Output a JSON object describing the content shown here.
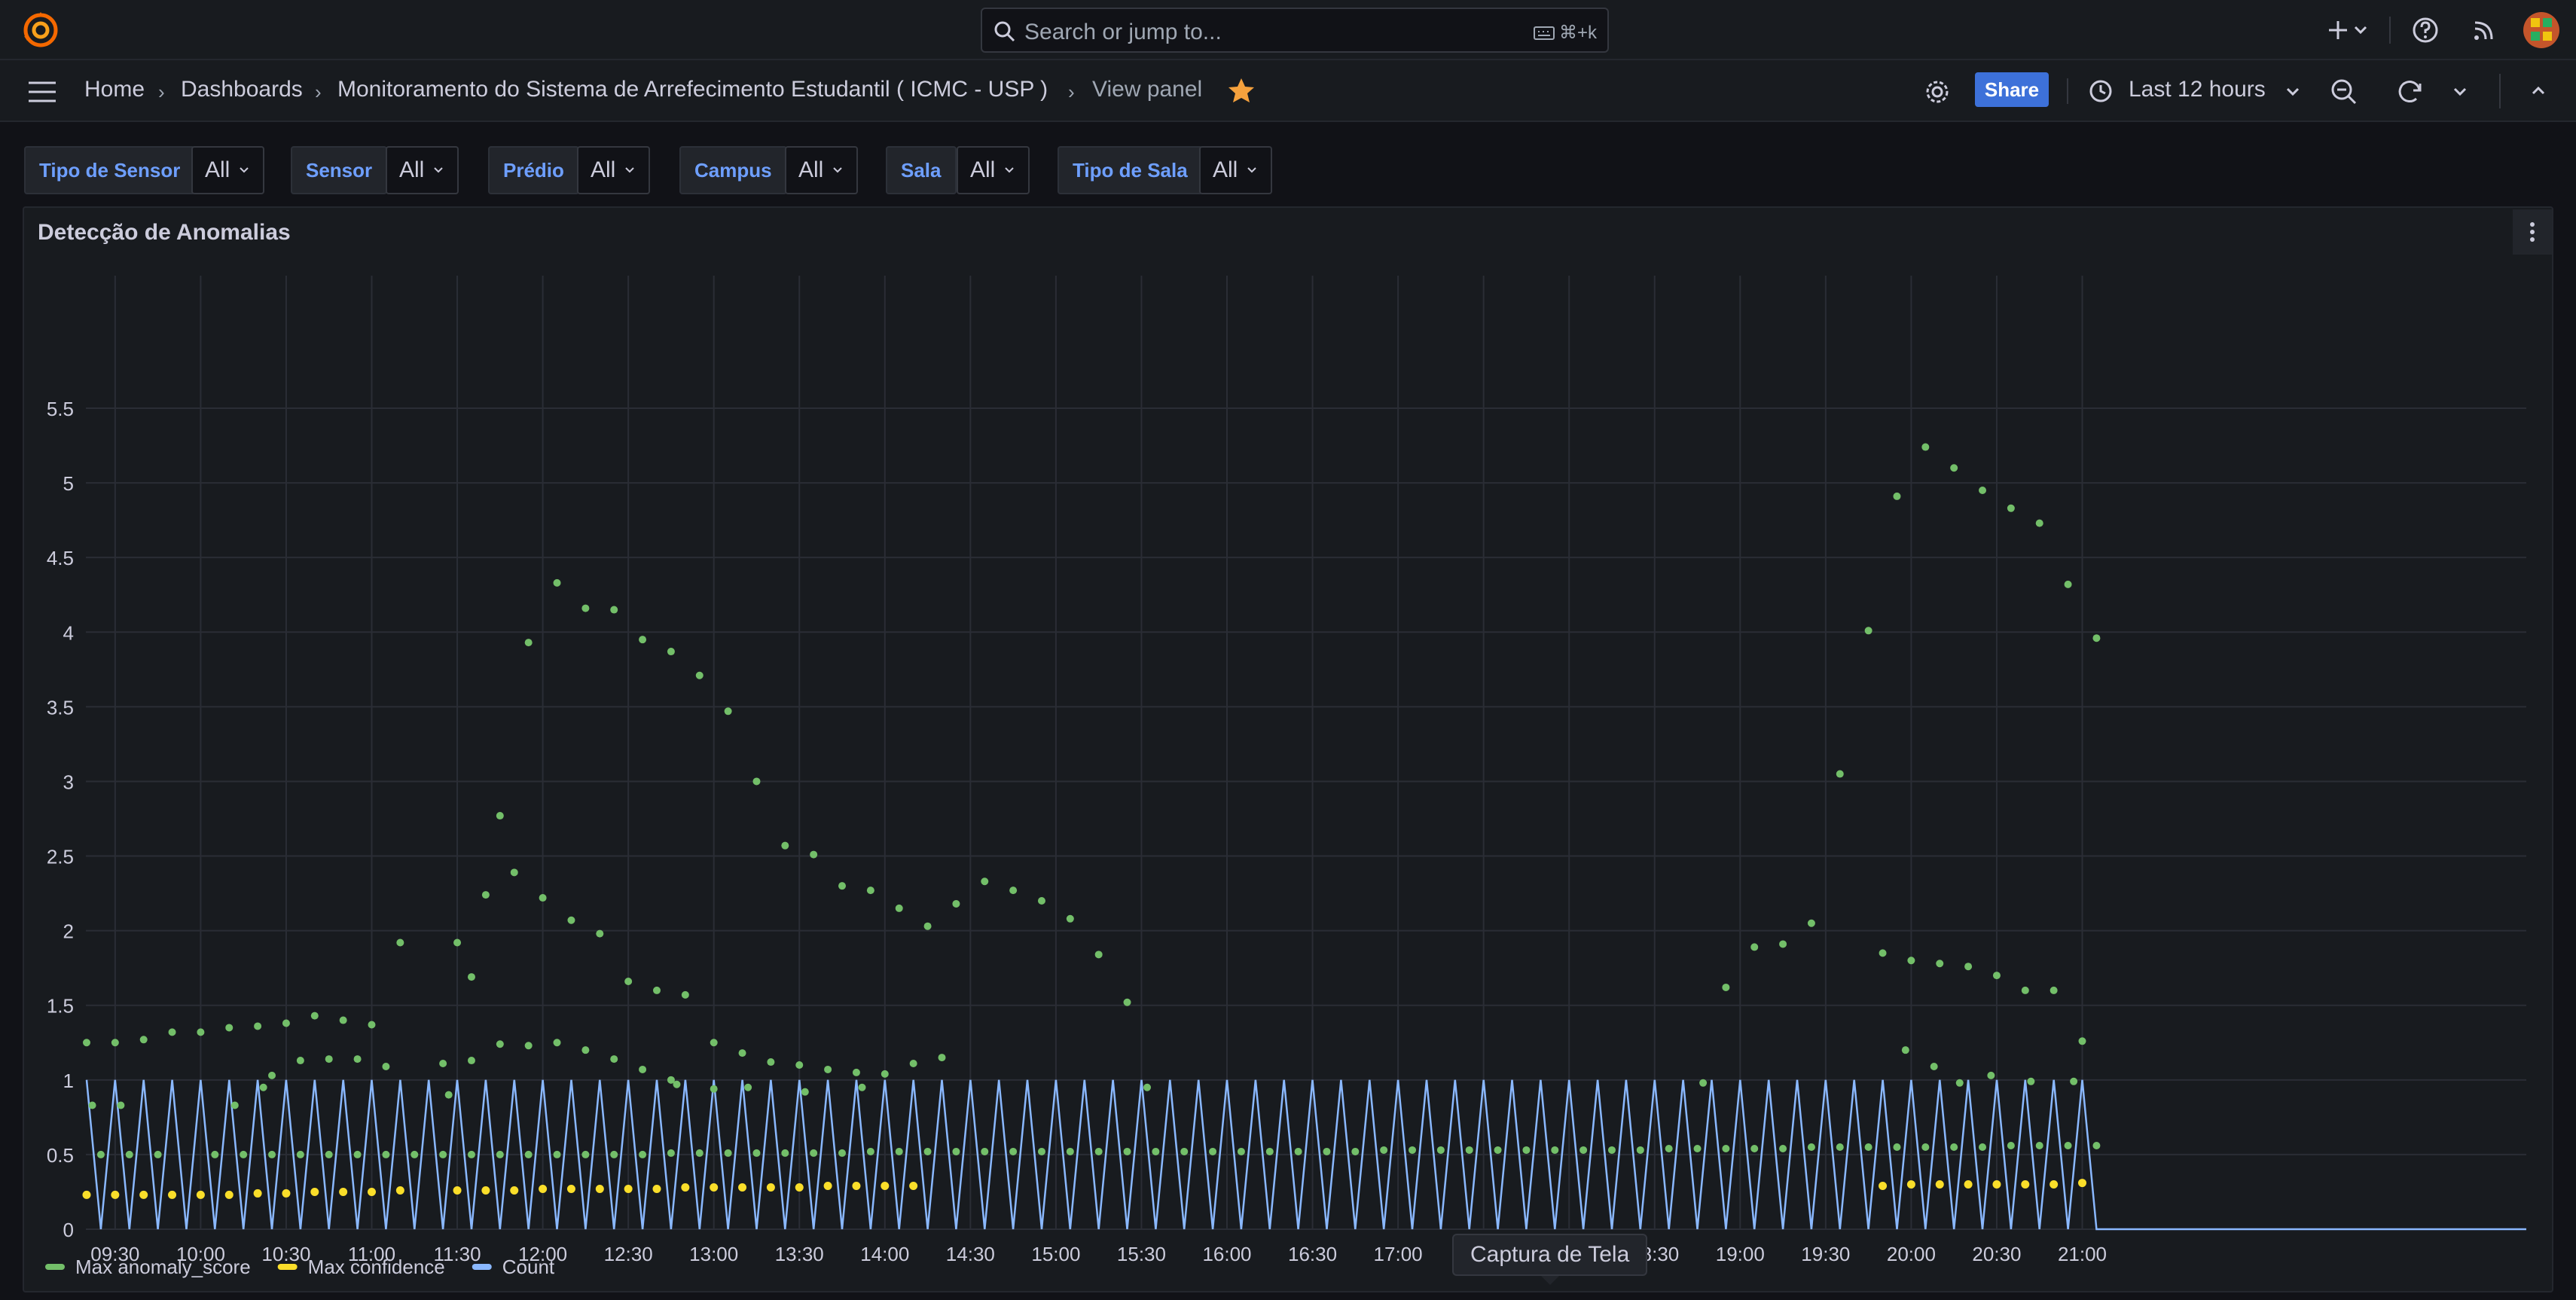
{
  "topbar": {
    "search_placeholder": "Search or jump to...",
    "search_shortcut": "⌘+k",
    "icons": [
      "grafana-logo-icon",
      "search-icon",
      "keyboard-icon",
      "plus-icon",
      "chevron-down-icon",
      "help-icon",
      "news-rss-icon",
      "user-avatar"
    ]
  },
  "nav": {
    "breadcrumbs": [
      "Home",
      "Dashboards",
      "Monitoramento do Sistema de Arrefecimento Estudantil ( ICMC - USP )",
      "View panel"
    ],
    "share_label": "Share",
    "time_range": "Last 12 hours",
    "icons": [
      "menu-icon",
      "star-icon",
      "gear-icon",
      "clock-icon",
      "zoom-out-icon",
      "refresh-icon",
      "chevron-down-icon",
      "chevron-up-icon"
    ]
  },
  "filters": [
    {
      "label": "Tipo de Sensor",
      "value": "All"
    },
    {
      "label": "Sensor",
      "value": "All"
    },
    {
      "label": "Prédio",
      "value": "All"
    },
    {
      "label": "Campus",
      "value": "All"
    },
    {
      "label": "Sala",
      "value": "All"
    },
    {
      "label": "Tipo de Sala",
      "value": "All"
    }
  ],
  "panel": {
    "title": "Detecção de Anomalias"
  },
  "tooltip": "Captura de Tela",
  "colors": {
    "anomaly": "#73bf69",
    "confidence": "#fade2a",
    "count": "#8ab8ff",
    "accent": "#3d71d9",
    "star": "#f5a13d"
  },
  "chart_data": {
    "type": "line",
    "x_unit": "time (HH:MM), one sample every 5 minutes",
    "x_start": "09:20",
    "x_step_minutes": 5,
    "x_tick_labels": [
      "09:30",
      "10:00",
      "10:30",
      "11:00",
      "11:30",
      "12:00",
      "12:30",
      "13:00",
      "13:30",
      "14:00",
      "14:30",
      "15:00",
      "15:30",
      "16:00",
      "16:30",
      "17:00",
      "17:30",
      "18:00",
      "18:30",
      "19:00",
      "19:30",
      "20:00",
      "20:30",
      "21:00"
    ],
    "y_tick_labels": [
      "0",
      "0.5",
      "1",
      "1.5",
      "2",
      "2.5",
      "3",
      "3.5",
      "4",
      "4.5",
      "5",
      "5.5"
    ],
    "ylim": [
      0,
      5.5
    ],
    "grid": true,
    "legend_position": "bottom-left",
    "series": [
      {
        "name": "Max anomaly_score",
        "style": "points",
        "points": [
          [
            "09:20",
            1.25
          ],
          [
            "09:30",
            1.25
          ],
          [
            "09:40",
            1.27
          ],
          [
            "09:50",
            1.32
          ],
          [
            "10:00",
            1.32
          ],
          [
            "10:10",
            1.35
          ],
          [
            "10:20",
            1.36
          ],
          [
            "10:30",
            1.38
          ],
          [
            "10:40",
            1.43
          ],
          [
            "10:50",
            1.4
          ],
          [
            "11:00",
            1.37
          ],
          [
            "11:10",
            1.92
          ],
          [
            "11:30",
            1.92
          ],
          [
            "11:35",
            1.69
          ],
          [
            "11:40",
            2.24
          ],
          [
            "11:45",
            2.77
          ],
          [
            "11:50",
            2.39
          ],
          [
            "11:55",
            3.93
          ],
          [
            "12:00",
            2.22
          ],
          [
            "12:05",
            4.33
          ],
          [
            "12:10",
            2.07
          ],
          [
            "12:15",
            4.16
          ],
          [
            "12:20",
            1.98
          ],
          [
            "12:25",
            4.15
          ],
          [
            "12:30",
            1.66
          ],
          [
            "12:35",
            3.95
          ],
          [
            "12:40",
            1.6
          ],
          [
            "12:45",
            3.87
          ],
          [
            "12:50",
            1.57
          ],
          [
            "12:55",
            3.71
          ],
          [
            "13:05",
            3.47
          ],
          [
            "13:15",
            3.0
          ],
          [
            "13:25",
            2.57
          ],
          [
            "13:35",
            2.51
          ],
          [
            "13:45",
            2.3
          ],
          [
            "13:55",
            2.27
          ],
          [
            "14:05",
            2.15
          ],
          [
            "14:15",
            2.03
          ],
          [
            "14:25",
            2.18
          ],
          [
            "14:35",
            2.33
          ],
          [
            "14:45",
            2.27
          ],
          [
            "14:55",
            2.2
          ],
          [
            "15:05",
            2.08
          ],
          [
            "15:15",
            1.84
          ],
          [
            "15:25",
            1.52
          ],
          [
            "10:25",
            1.03
          ],
          [
            "10:35",
            1.13
          ],
          [
            "10:45",
            1.14
          ],
          [
            "10:55",
            1.14
          ],
          [
            "11:05",
            1.09
          ],
          [
            "11:25",
            1.11
          ],
          [
            "11:35",
            1.13
          ],
          [
            "11:45",
            1.24
          ],
          [
            "11:55",
            1.23
          ],
          [
            "12:05",
            1.25
          ],
          [
            "12:15",
            1.2
          ],
          [
            "12:25",
            1.14
          ],
          [
            "12:35",
            1.07
          ],
          [
            "12:45",
            1.0
          ],
          [
            "13:00",
            1.25
          ],
          [
            "13:10",
            1.18
          ],
          [
            "13:20",
            1.12
          ],
          [
            "13:30",
            1.1
          ],
          [
            "13:40",
            1.07
          ],
          [
            "13:50",
            1.05
          ],
          [
            "14:00",
            1.04
          ],
          [
            "14:10",
            1.11
          ],
          [
            "14:20",
            1.15
          ],
          [
            "09:22",
            0.83
          ],
          [
            "09:32",
            0.83
          ],
          [
            "10:12",
            0.83
          ],
          [
            "10:22",
            0.95
          ],
          [
            "11:27",
            0.9
          ],
          [
            "12:47",
            0.97
          ],
          [
            "13:00",
            0.94
          ],
          [
            "13:12",
            0.95
          ],
          [
            "13:32",
            0.92
          ],
          [
            "13:52",
            0.95
          ],
          [
            "15:32",
            0.95
          ],
          [
            "18:47",
            0.98
          ],
          [
            "20:17",
            0.98
          ],
          [
            "20:42",
            0.99
          ],
          [
            "20:57",
            0.99
          ],
          [
            "18:55",
            1.62
          ],
          [
            "19:05",
            1.89
          ],
          [
            "19:15",
            1.91
          ],
          [
            "19:25",
            2.05
          ],
          [
            "19:35",
            3.05
          ],
          [
            "19:45",
            4.01
          ],
          [
            "19:55",
            4.91
          ],
          [
            "20:05",
            5.24
          ],
          [
            "20:15",
            5.1
          ],
          [
            "20:25",
            4.95
          ],
          [
            "20:35",
            4.83
          ],
          [
            "20:45",
            4.73
          ],
          [
            "20:55",
            4.32
          ],
          [
            "21:05",
            3.96
          ],
          [
            "19:50",
            1.85
          ],
          [
            "20:00",
            1.8
          ],
          [
            "20:10",
            1.78
          ],
          [
            "20:20",
            1.76
          ],
          [
            "20:30",
            1.7
          ],
          [
            "20:40",
            1.6
          ],
          [
            "20:50",
            1.6
          ],
          [
            "21:00",
            1.26
          ],
          [
            "19:58",
            1.2
          ],
          [
            "20:08",
            1.09
          ],
          [
            "20:28",
            1.03
          ],
          [
            "09:25",
            0.5
          ],
          [
            "09:35",
            0.5
          ],
          [
            "09:45",
            0.5
          ],
          [
            "10:05",
            0.5
          ],
          [
            "10:15",
            0.5
          ],
          [
            "10:25",
            0.5
          ],
          [
            "10:35",
            0.5
          ],
          [
            "10:45",
            0.5
          ],
          [
            "10:55",
            0.5
          ],
          [
            "11:05",
            0.5
          ],
          [
            "11:15",
            0.5
          ],
          [
            "11:25",
            0.5
          ],
          [
            "11:35",
            0.5
          ],
          [
            "11:45",
            0.5
          ],
          [
            "11:55",
            0.5
          ],
          [
            "12:05",
            0.5
          ],
          [
            "12:15",
            0.5
          ],
          [
            "12:25",
            0.5
          ],
          [
            "12:35",
            0.5
          ],
          [
            "12:45",
            0.51
          ],
          [
            "12:55",
            0.51
          ],
          [
            "13:05",
            0.51
          ],
          [
            "13:15",
            0.51
          ],
          [
            "13:25",
            0.51
          ],
          [
            "13:35",
            0.51
          ],
          [
            "13:45",
            0.51
          ],
          [
            "13:55",
            0.52
          ],
          [
            "14:05",
            0.52
          ],
          [
            "14:15",
            0.52
          ],
          [
            "14:25",
            0.52
          ],
          [
            "14:35",
            0.52
          ],
          [
            "14:45",
            0.52
          ],
          [
            "14:55",
            0.52
          ],
          [
            "15:05",
            0.52
          ],
          [
            "15:15",
            0.52
          ],
          [
            "15:25",
            0.52
          ],
          [
            "15:35",
            0.52
          ],
          [
            "15:45",
            0.52
          ],
          [
            "15:55",
            0.52
          ],
          [
            "16:05",
            0.52
          ],
          [
            "16:15",
            0.52
          ],
          [
            "16:25",
            0.52
          ],
          [
            "16:35",
            0.52
          ],
          [
            "16:45",
            0.52
          ],
          [
            "16:55",
            0.53
          ],
          [
            "17:05",
            0.53
          ],
          [
            "17:15",
            0.53
          ],
          [
            "17:25",
            0.53
          ],
          [
            "17:35",
            0.53
          ],
          [
            "17:45",
            0.53
          ],
          [
            "17:55",
            0.53
          ],
          [
            "18:05",
            0.53
          ],
          [
            "18:15",
            0.53
          ],
          [
            "18:25",
            0.53
          ],
          [
            "18:35",
            0.54
          ],
          [
            "18:45",
            0.54
          ],
          [
            "18:55",
            0.54
          ],
          [
            "19:05",
            0.54
          ],
          [
            "19:15",
            0.54
          ],
          [
            "19:25",
            0.55
          ],
          [
            "19:35",
            0.55
          ],
          [
            "19:45",
            0.55
          ],
          [
            "19:55",
            0.55
          ],
          [
            "20:05",
            0.55
          ],
          [
            "20:15",
            0.55
          ],
          [
            "20:25",
            0.55
          ],
          [
            "20:35",
            0.56
          ],
          [
            "20:45",
            0.56
          ],
          [
            "20:55",
            0.56
          ],
          [
            "21:05",
            0.56
          ]
        ]
      },
      {
        "name": "Max confidence",
        "style": "points",
        "points": [
          [
            "09:20",
            0.23
          ],
          [
            "09:30",
            0.23
          ],
          [
            "09:40",
            0.23
          ],
          [
            "09:50",
            0.23
          ],
          [
            "10:00",
            0.23
          ],
          [
            "10:10",
            0.23
          ],
          [
            "10:20",
            0.24
          ],
          [
            "10:30",
            0.24
          ],
          [
            "10:40",
            0.25
          ],
          [
            "10:50",
            0.25
          ],
          [
            "11:00",
            0.25
          ],
          [
            "11:10",
            0.26
          ],
          [
            "11:30",
            0.26
          ],
          [
            "11:40",
            0.26
          ],
          [
            "11:50",
            0.26
          ],
          [
            "12:00",
            0.27
          ],
          [
            "12:10",
            0.27
          ],
          [
            "12:20",
            0.27
          ],
          [
            "12:30",
            0.27
          ],
          [
            "12:40",
            0.27
          ],
          [
            "12:50",
            0.28
          ],
          [
            "13:00",
            0.28
          ],
          [
            "13:10",
            0.28
          ],
          [
            "13:20",
            0.28
          ],
          [
            "13:30",
            0.28
          ],
          [
            "13:40",
            0.29
          ],
          [
            "13:50",
            0.29
          ],
          [
            "14:00",
            0.29
          ],
          [
            "14:10",
            0.29
          ],
          [
            "19:50",
            0.29
          ],
          [
            "20:00",
            0.3
          ],
          [
            "20:10",
            0.3
          ],
          [
            "20:20",
            0.3
          ],
          [
            "20:30",
            0.3
          ],
          [
            "20:40",
            0.3
          ],
          [
            "20:50",
            0.3
          ],
          [
            "21:00",
            0.31
          ]
        ]
      },
      {
        "name": "Count",
        "style": "line",
        "description": "alternates between 0 and 1 every 5 minutes from 09:20 to 21:05, then stays at 0"
      }
    ]
  }
}
